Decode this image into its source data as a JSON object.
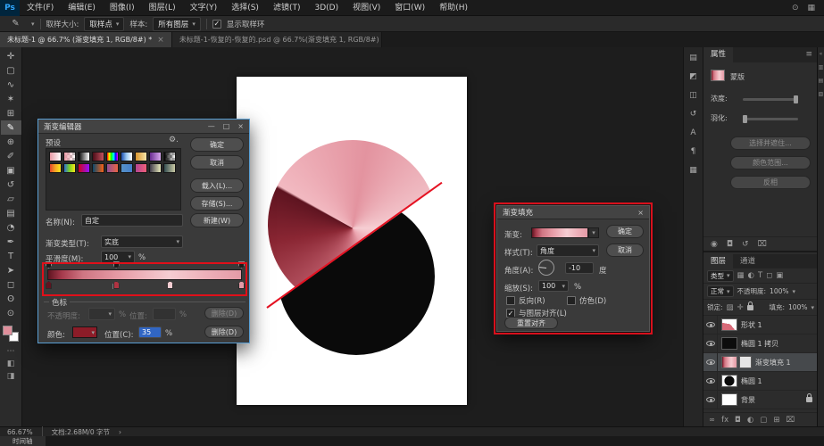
{
  "app": {
    "logo": "Ps",
    "menus": [
      "文件(F)",
      "编辑(E)",
      "图像(I)",
      "图层(L)",
      "文字(Y)",
      "选择(S)",
      "滤镜(T)",
      "3D(D)",
      "视图(V)",
      "窗口(W)",
      "帮助(H)"
    ],
    "menubar_icons": [
      {
        "name": "search-icon",
        "glyph": "⊙"
      },
      {
        "name": "workspace-switcher-icon",
        "glyph": "▦"
      }
    ]
  },
  "icons": {
    "caret": "▾"
  },
  "options_bar": {
    "tool_icon": "✎",
    "sample_size_label": "取样大小:",
    "sample_size_value": "取样点",
    "sample_label": "样本:",
    "sample_value": "所有图层",
    "check_glyph": "✓",
    "show_ring_label": "显示取样环"
  },
  "tabs": [
    {
      "label": "未标题-1 @ 66.7% (渐变填充 1, RGB/8#) *",
      "close": "×"
    },
    {
      "label": "未标题-1-恢复的-恢复的.psd @ 66.7%(渐变填充 1, RGB/8#) *",
      "close": "×"
    }
  ],
  "toolbar": {
    "tools": [
      {
        "name": "move-tool",
        "glyph": "✛"
      },
      {
        "name": "marquee-tool",
        "glyph": "▢"
      },
      {
        "name": "lasso-tool",
        "glyph": "∿"
      },
      {
        "name": "quick-selection-tool",
        "glyph": "✶"
      },
      {
        "name": "crop-tool",
        "glyph": "⊞"
      },
      {
        "name": "eyedropper-tool",
        "glyph": "✎",
        "selected": true
      },
      {
        "name": "spot-healing-tool",
        "glyph": "⊕"
      },
      {
        "name": "brush-tool",
        "glyph": "✐"
      },
      {
        "name": "clone-stamp-tool",
        "glyph": "▣"
      },
      {
        "name": "history-brush-tool",
        "glyph": "↺"
      },
      {
        "name": "eraser-tool",
        "glyph": "▱"
      },
      {
        "name": "gradient-tool",
        "glyph": "▤"
      },
      {
        "name": "blur-tool",
        "glyph": "◔"
      },
      {
        "name": "pen-tool",
        "glyph": "✒"
      },
      {
        "name": "type-tool",
        "glyph": "T"
      },
      {
        "name": "path-selection-tool",
        "glyph": "➤"
      },
      {
        "name": "shape-tool",
        "glyph": "◻"
      },
      {
        "name": "hand-tool",
        "glyph": "ʘ"
      },
      {
        "name": "zoom-tool",
        "glyph": "⊙"
      }
    ],
    "extras": [
      {
        "name": "edit-toolbar-icon",
        "glyph": "⋯"
      },
      {
        "name": "quick-mask-icon",
        "glyph": "◧"
      },
      {
        "name": "screen-mode-icon",
        "glyph": "◨"
      }
    ],
    "fg_color": "#df8f9b",
    "bg_color": "#ffffff"
  },
  "art": {
    "pink_conic": "conic-gradient(from 300deg at 50% 52%, #f2b9c1 0deg, #e3939f 70deg, #f6ced3 150deg, #eba4af 210deg, #c05f6d 265deg, #8a2633 320deg, #5e1420 358deg, #f2b9c1 360deg)",
    "black": "#0a0a0a",
    "line_red": "#e51222"
  },
  "gradient_editor": {
    "title": "渐变编辑器",
    "window_icons": {
      "minimize": "—",
      "maximize": "□",
      "close": "×"
    },
    "presets_label": "预设",
    "gear_icon": "⚙.",
    "presets": [
      "linear-gradient(90deg,#e89aa5,#ffffff)",
      "linear-gradient(90deg,#e89aa5,rgba(232,154,165,0)),repeating-conic-gradient(#b8b8b8 0% 25%,#ffffff 0% 50%) 0 0/6px 6px",
      "linear-gradient(90deg,#000000,#ffffff)",
      "linear-gradient(90deg,#4a0d18,#c2505e)",
      "linear-gradient(90deg,#ff0000,#ffff00,#00ff00,#00ffff,#0000ff,#ff00ff)",
      "linear-gradient(90deg,#1c4fae,#9ecbf2,#ffffff)",
      "linear-gradient(90deg,#d9952f,#f7e6a8)",
      "linear-gradient(90deg,#6a2d91,#d9a8ee)",
      "linear-gradient(90deg,#000000,rgba(0,0,0,0)),repeating-conic-gradient(#b8b8b8 0% 25%,#ffffff 0% 50%) 0 0/6px 6px",
      "linear-gradient(90deg,#e2452b,#f5a623,#f8e71c)",
      "linear-gradient(90deg,#2e6fd3,#7ed321,#f8e71c)",
      "linear-gradient(90deg,#d0021b,#9013fe)",
      "linear-gradient(90deg,#0b486b,#f56217)",
      "linear-gradient(90deg,#904e95,#e96443)",
      "linear-gradient(90deg,#5691c8,#457fca)",
      "linear-gradient(90deg,#b24592,#f15f79)",
      "linear-gradient(90deg,#403b4a,#e7e9bb)",
      "linear-gradient(90deg,#334d50,#cbcaa5)"
    ],
    "ok": "确定",
    "cancel": "取消",
    "load": "载入(L)...",
    "save": "存储(S)...",
    "name_label": "名称(N):",
    "name_value": "自定",
    "new_btn": "新建(W)",
    "type_label": "渐变类型(T):",
    "type_value": "实底",
    "smooth_label": "平滑度(M):",
    "smooth_value": "100",
    "percent": "%",
    "strip_gradient": "linear-gradient(90deg,#5e1420 0%,#a63a4c 7%,#cf7683 18%,#e598a3 35%,#efb5bd 50%,#f5cdd2 63%,#edb0b9 82%,#e49aa6 100%)",
    "stops_group_label": "色标",
    "opacity_label": "不透明度:",
    "position_label": "位置:",
    "delete_label": "删除(D)",
    "color_label": "颜色:",
    "color_swatch": "#8c1c28",
    "position_c_label": "位置(C):",
    "position_c_value": "35",
    "opacity_stops": [
      0,
      35,
      100
    ],
    "color_stops": [
      {
        "pos": 0,
        "color": "#5e1420",
        "selected": false
      },
      {
        "pos": 35,
        "color": "#b03342",
        "selected": true
      },
      {
        "pos": 63,
        "color": "#f5cdd2",
        "selected": false
      },
      {
        "pos": 100,
        "color": "#e49aa6",
        "selected": false
      }
    ]
  },
  "gradient_fill": {
    "title": "渐变填充",
    "close_icon": "×",
    "gradient_label": "渐变:",
    "ok": "确定",
    "cancel": "取消",
    "style_label": "样式(T):",
    "style_value": "角度",
    "angle_label": "角度(A):",
    "angle_value": "-10",
    "degree_label": "度",
    "scale_label": "缩放(S):",
    "scale_value": "100",
    "percent": "%",
    "reverse_label": "反向(R)",
    "dither_label": "仿色(D)",
    "align_label": "与图层对齐(L)",
    "reset_btn": "重置对齐"
  },
  "properties": {
    "title": "属性",
    "menu_icon": "≡",
    "mask_label": "蒙版",
    "density_label": "浓度:",
    "feather_label": "羽化:",
    "buttons": [
      "选择并遮住...",
      "颜色范围...",
      "反相"
    ],
    "bottom_icons": [
      {
        "name": "mask-apply-icon",
        "glyph": "◉"
      },
      {
        "name": "mask-view-icon",
        "glyph": "◘"
      },
      {
        "name": "reset-icon",
        "glyph": "↺"
      },
      {
        "name": "delete-icon",
        "glyph": "⌧"
      }
    ]
  },
  "layers_panel": {
    "tab_layers": "图层",
    "tab_channels": "通道",
    "filter_label": "类型",
    "filter_icons": [
      {
        "name": "filter-pixel-icon",
        "glyph": "▦"
      },
      {
        "name": "filter-adjustment-icon",
        "glyph": "◐"
      },
      {
        "name": "filter-type-icon",
        "glyph": "T"
      },
      {
        "name": "filter-shape-icon",
        "glyph": "◻"
      },
      {
        "name": "filter-smart-icon",
        "glyph": "▣"
      }
    ],
    "blend_mode": "正常",
    "opacity_label": "不透明度:",
    "opacity_value": "100%",
    "lock_label": "锁定:",
    "lock_icons": [
      {
        "name": "lock-transparency-icon",
        "glyph": "▨"
      },
      {
        "name": "lock-position-icon",
        "glyph": "✛"
      }
    ],
    "fill_label": "填充:",
    "fill_value": "100%",
    "layers": [
      {
        "name": "形状 1"
      },
      {
        "name": "椭圆 1 拷贝"
      },
      {
        "name": "渐变填充 1",
        "selected": true
      },
      {
        "name": "椭圆 1"
      },
      {
        "name": "背景"
      }
    ],
    "bottom_icons": [
      {
        "name": "link-layers-icon",
        "glyph": "∞"
      },
      {
        "name": "layer-effects-icon",
        "glyph": "fx"
      },
      {
        "name": "add-mask-icon",
        "glyph": "◘"
      },
      {
        "name": "adjustment-layer-icon",
        "glyph": "◐"
      },
      {
        "name": "new-group-icon",
        "glyph": "▢"
      },
      {
        "name": "new-layer-icon",
        "glyph": "⊞"
      },
      {
        "name": "delete-layer-icon",
        "glyph": "⌧"
      }
    ]
  },
  "right_strip": {
    "icons": [
      {
        "name": "color-panel-icon",
        "glyph": "▤"
      },
      {
        "name": "adjustments-panel-icon",
        "glyph": "◩"
      },
      {
        "name": "libraries-panel-icon",
        "glyph": "◫"
      },
      {
        "name": "history-panel-icon",
        "glyph": "↺"
      },
      {
        "name": "character-panel-icon",
        "glyph": "A"
      },
      {
        "name": "paragraph-panel-icon",
        "glyph": "¶"
      },
      {
        "name": "info-panel-icon",
        "glyph": "▦"
      }
    ]
  },
  "right_edge": {
    "icons": [
      {
        "name": "collapse-panels-icon",
        "glyph": "«"
      },
      {
        "name": "dock-icon-1",
        "glyph": "▥"
      },
      {
        "name": "dock-icon-2",
        "glyph": "▤"
      },
      {
        "name": "dock-icon-3",
        "glyph": "▧"
      }
    ]
  },
  "status_bar": {
    "zoom": "66.67%",
    "doc_info": "文档:2.68M/0 字节",
    "chevron": "›"
  },
  "timeline": {
    "label": "时间轴"
  }
}
